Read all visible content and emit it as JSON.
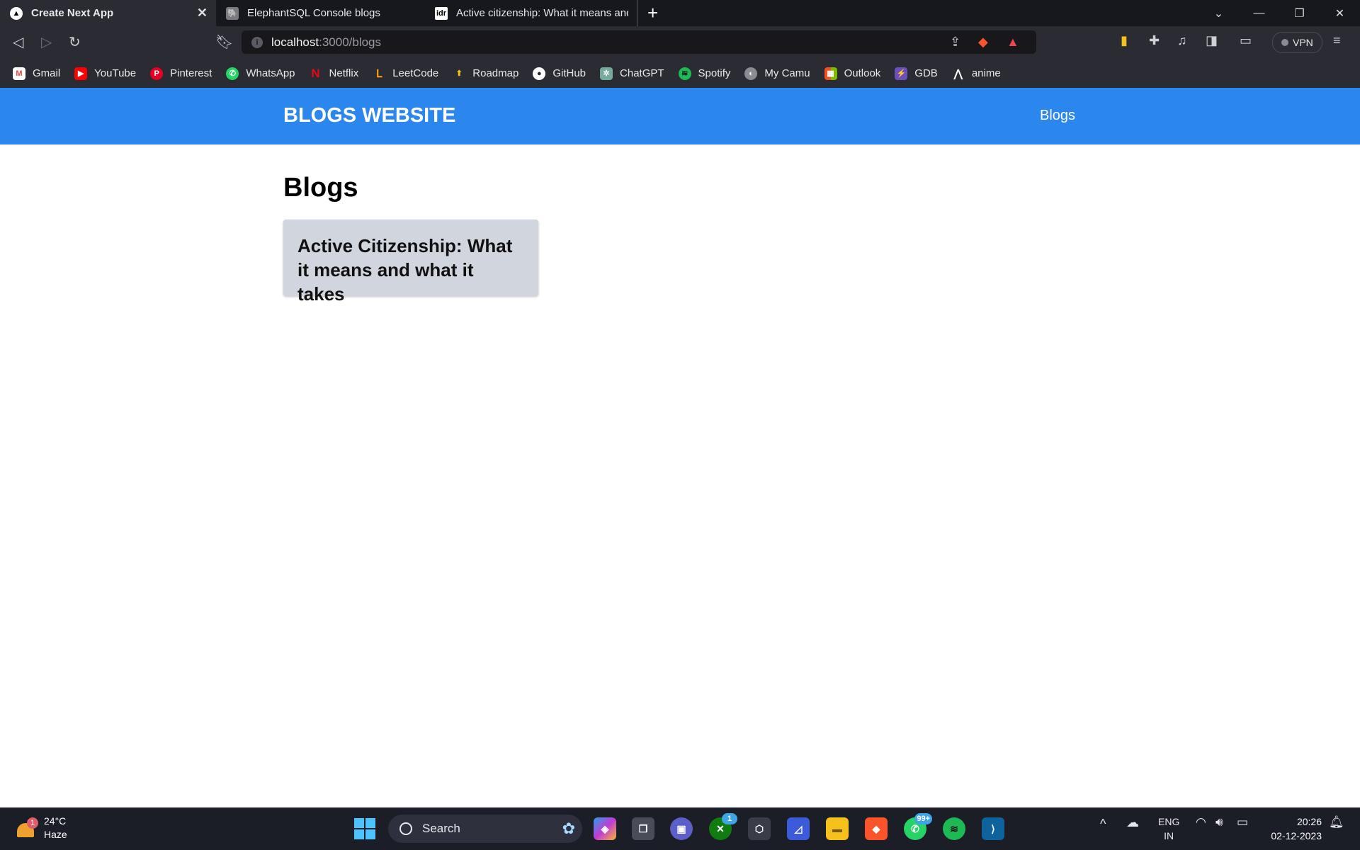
{
  "browser": {
    "tabs": [
      {
        "title": "Create Next App",
        "active": true
      },
      {
        "title": "ElephantSQL Console blogs",
        "active": false
      },
      {
        "title": "Active citizenship: What it means and what it takes",
        "active": false
      }
    ],
    "address": {
      "host": "localhost",
      "rest": ":3000/blogs"
    },
    "vpn_label": "VPN",
    "bookmarks": [
      {
        "label": "Gmail",
        "icon": "gmail-icon"
      },
      {
        "label": "YouTube",
        "icon": "youtube-icon"
      },
      {
        "label": "Pinterest",
        "icon": "pinterest-icon"
      },
      {
        "label": "WhatsApp",
        "icon": "whatsapp-icon"
      },
      {
        "label": "Netflix",
        "icon": "netflix-icon"
      },
      {
        "label": "LeetCode",
        "icon": "leetcode-icon"
      },
      {
        "label": "Roadmap",
        "icon": "roadmap-icon"
      },
      {
        "label": "GitHub",
        "icon": "github-icon"
      },
      {
        "label": "ChatGPT",
        "icon": "chatgpt-icon"
      },
      {
        "label": "Spotify",
        "icon": "spotify-icon"
      },
      {
        "label": "My Camu",
        "icon": "camu-icon"
      },
      {
        "label": "Outlook",
        "icon": "outlook-icon"
      },
      {
        "label": "GDB",
        "icon": "gdb-icon"
      },
      {
        "label": "anime",
        "icon": "anime-icon"
      }
    ]
  },
  "site": {
    "brand": "BLOGS WEBSITE",
    "nav_link": "Blogs",
    "page_title": "Blogs",
    "posts": [
      {
        "title": "Active Citizenship: What it means and what it takes"
      }
    ]
  },
  "taskbar": {
    "weather": {
      "badge": "1",
      "temp": "24°C",
      "condition": "Haze"
    },
    "search_label": "Search",
    "xbox_badge": "1",
    "whatsapp_badge": "99+",
    "language": {
      "line1": "ENG",
      "line2": "IN"
    },
    "time": "20:26",
    "date": "02-12-2023"
  },
  "colors": {
    "navbar": "#2b86ed",
    "card": "#d0d5de",
    "browser_dark": "#17171e",
    "toolbar": "#2a2b33",
    "taskbar": "#1c1e27"
  }
}
